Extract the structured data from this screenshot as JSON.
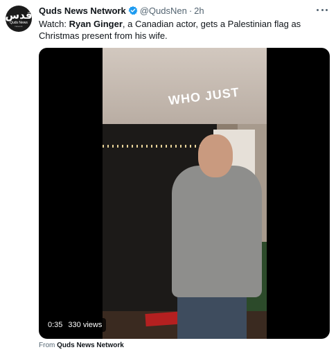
{
  "tweet": {
    "avatar": {
      "glyph": "قدس",
      "name": "Quds News",
      "sub": "Network"
    },
    "display_name": "Quds News Network",
    "verified_icon": "verified-badge-icon",
    "handle": "@QudsNen",
    "separator": "·",
    "time": "2h",
    "more_icon": "more-options-icon",
    "text": {
      "prefix": "Watch: ",
      "bold": "Ryan Ginger",
      "rest": ", a Canadian actor, gets a Palestinian flag as Christmas present from his wife."
    },
    "media": {
      "overlay_text": "WHO JUST",
      "duration": "0:35",
      "views": "330 views"
    },
    "source": {
      "prefix": "From ",
      "name": "Quds News Network"
    }
  },
  "colors": {
    "accent": "#1d9bf0",
    "text_primary": "#0f1419",
    "text_secondary": "#536471"
  }
}
